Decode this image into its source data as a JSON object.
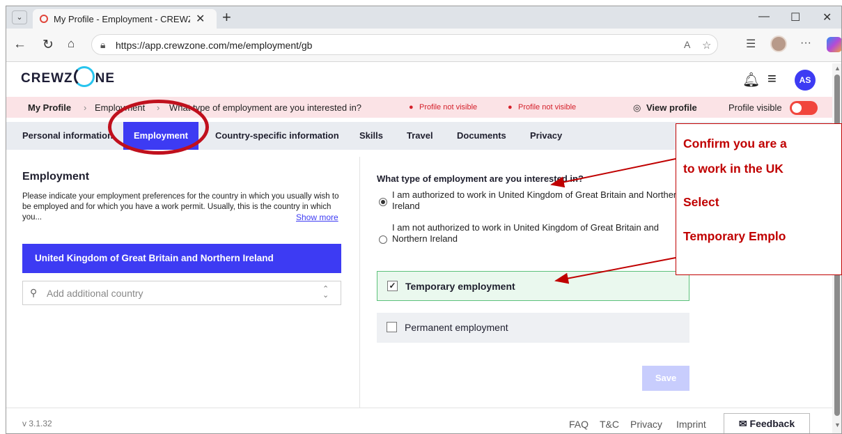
{
  "browser": {
    "tab_title": "My Profile - Employment - CREWZ",
    "url": "https://app.crewzone.com/me/employment/gb",
    "window_controls": [
      "—",
      "☐",
      "✕"
    ]
  },
  "app": {
    "logo": "CREWZONE",
    "user_initials": "AS"
  },
  "breadcrumb": {
    "items": [
      "My Profile",
      "Employment",
      "What type of employment are you interested in?"
    ],
    "warning_1": "Profile not visible",
    "warning_2": "Profile not visible",
    "view_profile": "View profile",
    "visibility_label": "Profile visible"
  },
  "tabs": [
    {
      "label": "Personal information"
    },
    {
      "label": "Employment",
      "active": true
    },
    {
      "label": "Country-specific information"
    },
    {
      "label": "Skills"
    },
    {
      "label": "Travel"
    },
    {
      "label": "Documents"
    },
    {
      "label": "Privacy"
    }
  ],
  "left_panel": {
    "title": "Employment",
    "description": "Please indicate your employment preferences for the country in which you usually wish to be employed and for which you have a work permit. Usually, this is the country in which you...",
    "show_more": "Show more",
    "selected_country": "United Kingdom of Great Britain and Northern Ireland",
    "add_country_placeholder": "Add additional country"
  },
  "right_panel": {
    "question": "What type of employment are you interested in?",
    "options": [
      {
        "label": "I am authorized to work in United Kingdom of Great Britain and Northern Ireland",
        "selected": true
      },
      {
        "label": "I am not authorized to work in United Kingdom of Great Britain and Northern Ireland",
        "selected": false
      }
    ],
    "checkboxes": [
      {
        "label": "Temporary employment",
        "checked": true
      },
      {
        "label": "Permanent employment",
        "checked": false
      }
    ],
    "save_label": "Save"
  },
  "footer": {
    "version": "v 3.1.32",
    "links": [
      "FAQ",
      "T&C",
      "Privacy",
      "Imprint"
    ],
    "feedback_label": "Feedback"
  },
  "annotation": {
    "line1": "Confirm you are a",
    "line2": "to work in the UK",
    "line3": "Select",
    "line4": "Temporary Emplo",
    "color": "#c00000"
  },
  "colors": {
    "brand": "#3d3bf3",
    "warning": "#d4202a",
    "toggle_off": "#f1453c"
  }
}
